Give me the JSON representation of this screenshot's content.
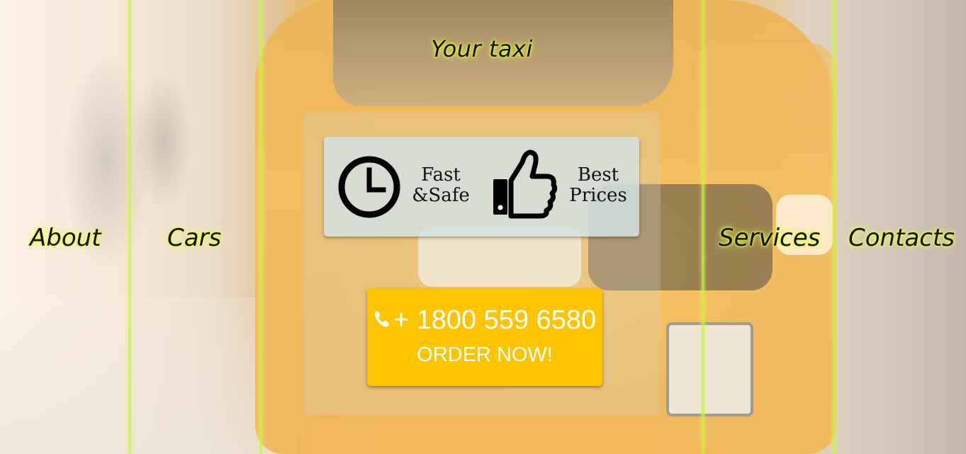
{
  "page": {
    "title": "Your taxi"
  },
  "nav": {
    "about": "About",
    "cars": "Cars",
    "services": "Services",
    "contacts": "Contacts"
  },
  "features": [
    {
      "icon": "clock-icon",
      "label_line1": "Fast",
      "label_line2": "&Safe"
    },
    {
      "icon": "thumbs-up-icon",
      "label_line1": "Best",
      "label_line2": "Prices"
    }
  ],
  "order": {
    "phone": "+ 1800 559 6580",
    "cta": "ORDER NOW!",
    "icon": "phone-icon"
  },
  "colors": {
    "accent_yellow": "#fdc400",
    "neon_glow": "#e8ff3a",
    "text_dark": "#111111"
  }
}
